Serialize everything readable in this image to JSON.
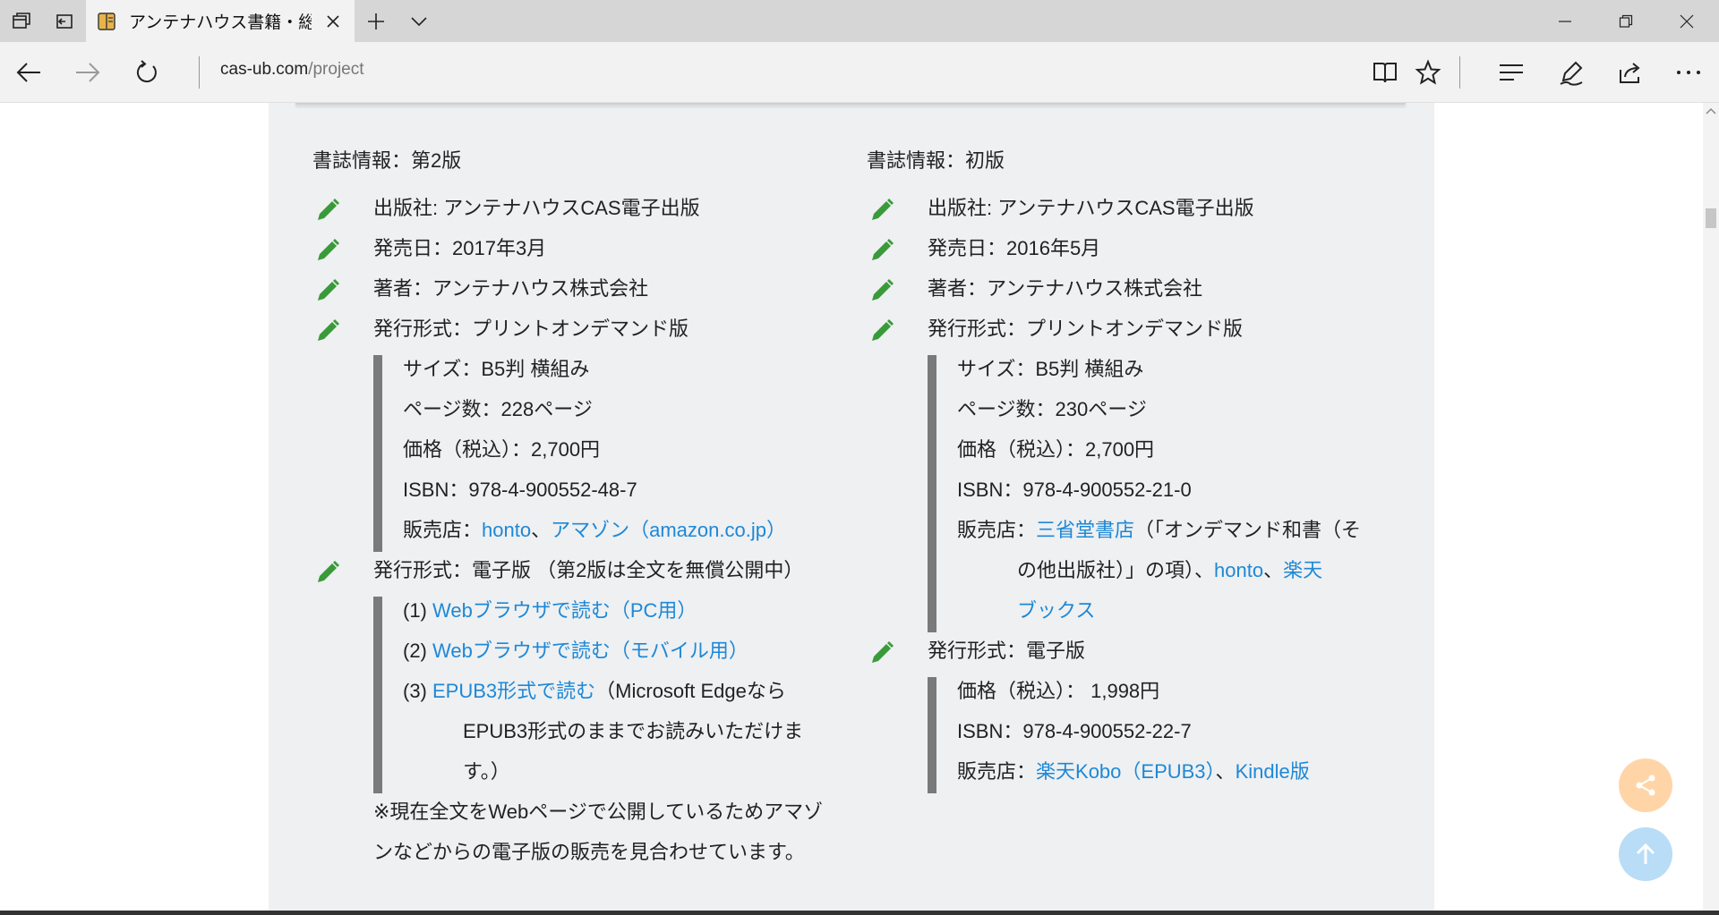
{
  "browser": {
    "tab_title": "アンテナハウス書籍・総合E",
    "address_host": "cas-ub.com",
    "address_path": "/project"
  },
  "left": {
    "title": "書誌情報：第2版",
    "publisher": "出版社: アンテナハウスCAS電子出版",
    "release_date": "発売日：2017年3月",
    "author": "著者：アンテナハウス株式会社",
    "format_print": "発行形式：プリントオンデマンド版",
    "print_details": {
      "size": "サイズ：B5判 横組み",
      "pages": "ページ数：228ページ",
      "price": "価格（税込）：2,700円",
      "isbn": "ISBN：978-4-900552-48-7",
      "shops_label": "販売店：",
      "shop1": "honto",
      "sep1": "、",
      "shop2": "アマゾン（amazon.co.jp）"
    },
    "format_ebook": "発行形式：電子版 （第2版は全文を無償公開中）",
    "ebook_details": {
      "item1_prefix": "(1) ",
      "item1_link": "Webブラウザで読む（PC用）",
      "item2_prefix": "(2) ",
      "item2_link": "Webブラウザで読む（モバイル用）",
      "item3_prefix": "(3) ",
      "item3_link": "EPUB3形式で読む",
      "item3_text": "（Microsoft Edgeなら",
      "item3_line2": "EPUB3形式のままでお読みいただけま",
      "item3_line3": "す。）"
    },
    "note_line1": "※現在全文をWebページで公開しているためアマゾ",
    "note_line2": "ンなどからの電子版の販売を見合わせています。"
  },
  "right": {
    "title": "書誌情報：初版",
    "publisher": "出版社: アンテナハウスCAS電子出版",
    "release_date": "発売日：2016年5月",
    "author": "著者：アンテナハウス株式会社",
    "format_print": "発行形式：プリントオンデマンド版",
    "print_details": {
      "size": "サイズ：B5判 横組み",
      "pages": "ページ数：230ページ",
      "price": "価格（税込）：2,700円",
      "isbn": "ISBN：978-4-900552-21-0",
      "shops_label": "販売店：",
      "shop1": "三省堂書店",
      "shop1_after": "（「オンデマンド和書（そ",
      "line2_text": "の他出版社）」の項）、",
      "shop2": "honto",
      "sep2": "、",
      "shop3_part1": "楽天",
      "shop3_part2": "ブックス"
    },
    "format_ebook": "発行形式：電子版",
    "ebook_details": {
      "price": "価格（税込）： 1,998円",
      "isbn": "ISBN：978-4-900552-22-7",
      "shops_label": "販売店：",
      "shop1": "楽天Kobo（EPUB3）",
      "sep1": "、",
      "shop2": "Kindle版"
    }
  },
  "colors": {
    "link": "#1e88d6",
    "pencil": "#3a9a3a",
    "share_fab": "#ffd5a8",
    "top_fab": "#b9dcf7"
  },
  "icons": [
    "tab-manager-icon",
    "tab-aside-icon",
    "favicon-book-icon",
    "close-icon",
    "new-tab-icon",
    "tab-list-chevron-icon",
    "minimize-icon",
    "maximize-icon",
    "window-close-icon",
    "back-icon",
    "forward-icon",
    "refresh-icon",
    "reading-view-icon",
    "favorite-star-icon",
    "hub-icon",
    "web-note-icon",
    "share-icon",
    "more-icon",
    "pencil-icon",
    "share-fab-icon",
    "arrow-up-icon"
  ]
}
